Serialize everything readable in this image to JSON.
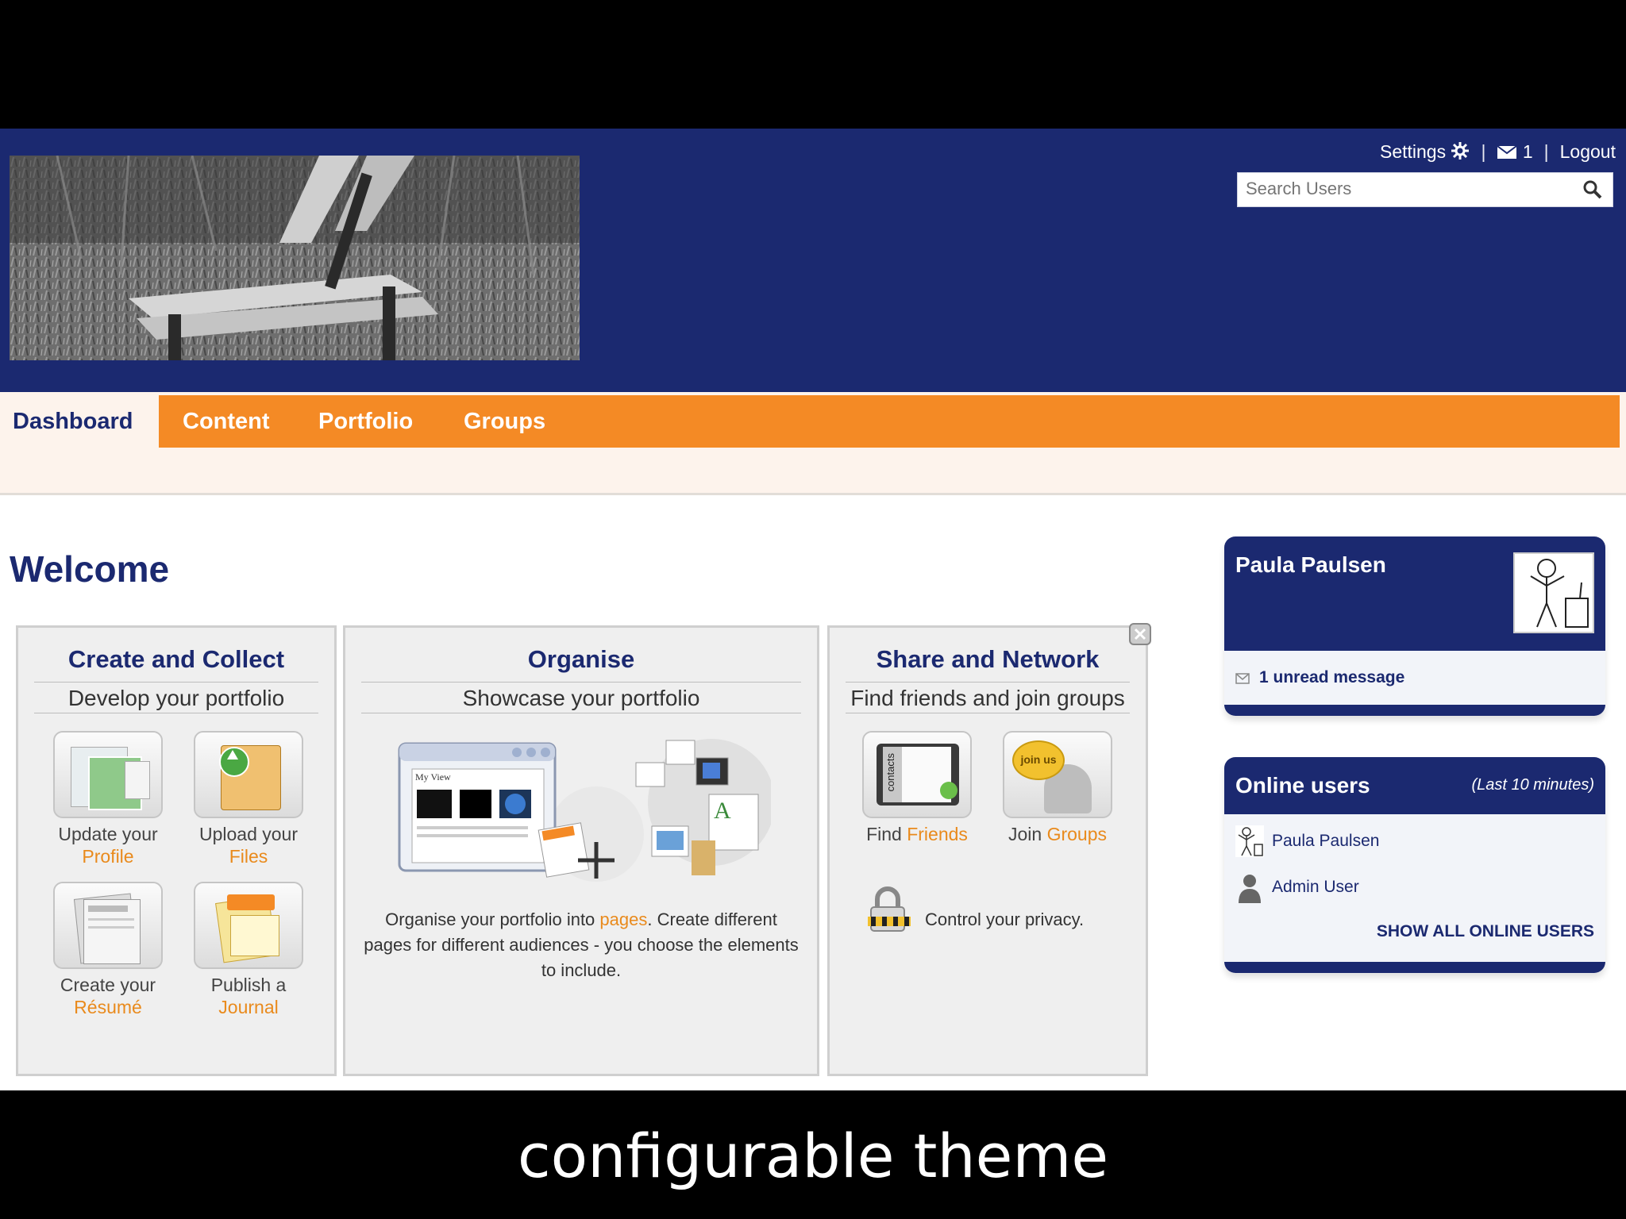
{
  "header": {
    "settings": "Settings",
    "messages_count": "1",
    "logout": "Logout",
    "search_placeholder": "Search Users"
  },
  "nav": {
    "tabs": [
      {
        "label": "Dashboard",
        "active": true
      },
      {
        "label": "Content"
      },
      {
        "label": "Portfolio"
      },
      {
        "label": "Groups"
      }
    ]
  },
  "main": {
    "welcome": "Welcome",
    "create": {
      "title": "Create and Collect",
      "subtitle": "Develop your portfolio",
      "tiles": [
        {
          "line1": "Update your",
          "line2": "Profile",
          "icon": "profile-icon"
        },
        {
          "line1": "Upload your",
          "line2": "Files",
          "icon": "upload-files-icon"
        },
        {
          "line1": "Create your",
          "line2": "Résumé",
          "icon": "resume-icon"
        },
        {
          "line1": "Publish a",
          "line2": "Journal",
          "icon": "journal-icon"
        }
      ]
    },
    "organise": {
      "title": "Organise",
      "subtitle": "Showcase your portfolio",
      "text_before": "Organise your portfolio into ",
      "text_link": "pages",
      "text_after": ". Create different pages for different audiences - you choose the elements to include.",
      "illustration_label": "My View"
    },
    "share": {
      "title": "Share and Network",
      "subtitle": "Find friends and join groups",
      "find_pre": "Find ",
      "find_link": "Friends",
      "join_pre": "Join ",
      "join_link": "Groups",
      "privacy": "Control your privacy.",
      "contacts_label": "contacts",
      "join_badge": "join us"
    }
  },
  "profile_block": {
    "name": "Paula Paulsen",
    "unread": "1 unread message"
  },
  "online_block": {
    "title": "Online users",
    "period": "(Last 10 minutes)",
    "users": [
      "Paula Paulsen",
      "Admin User"
    ],
    "show_all": "SHOW ALL ONLINE USERS"
  },
  "caption": "configurable theme",
  "colors": {
    "header": "#1b2970",
    "nav": "#f48a25",
    "accent": "#e98a1c"
  }
}
